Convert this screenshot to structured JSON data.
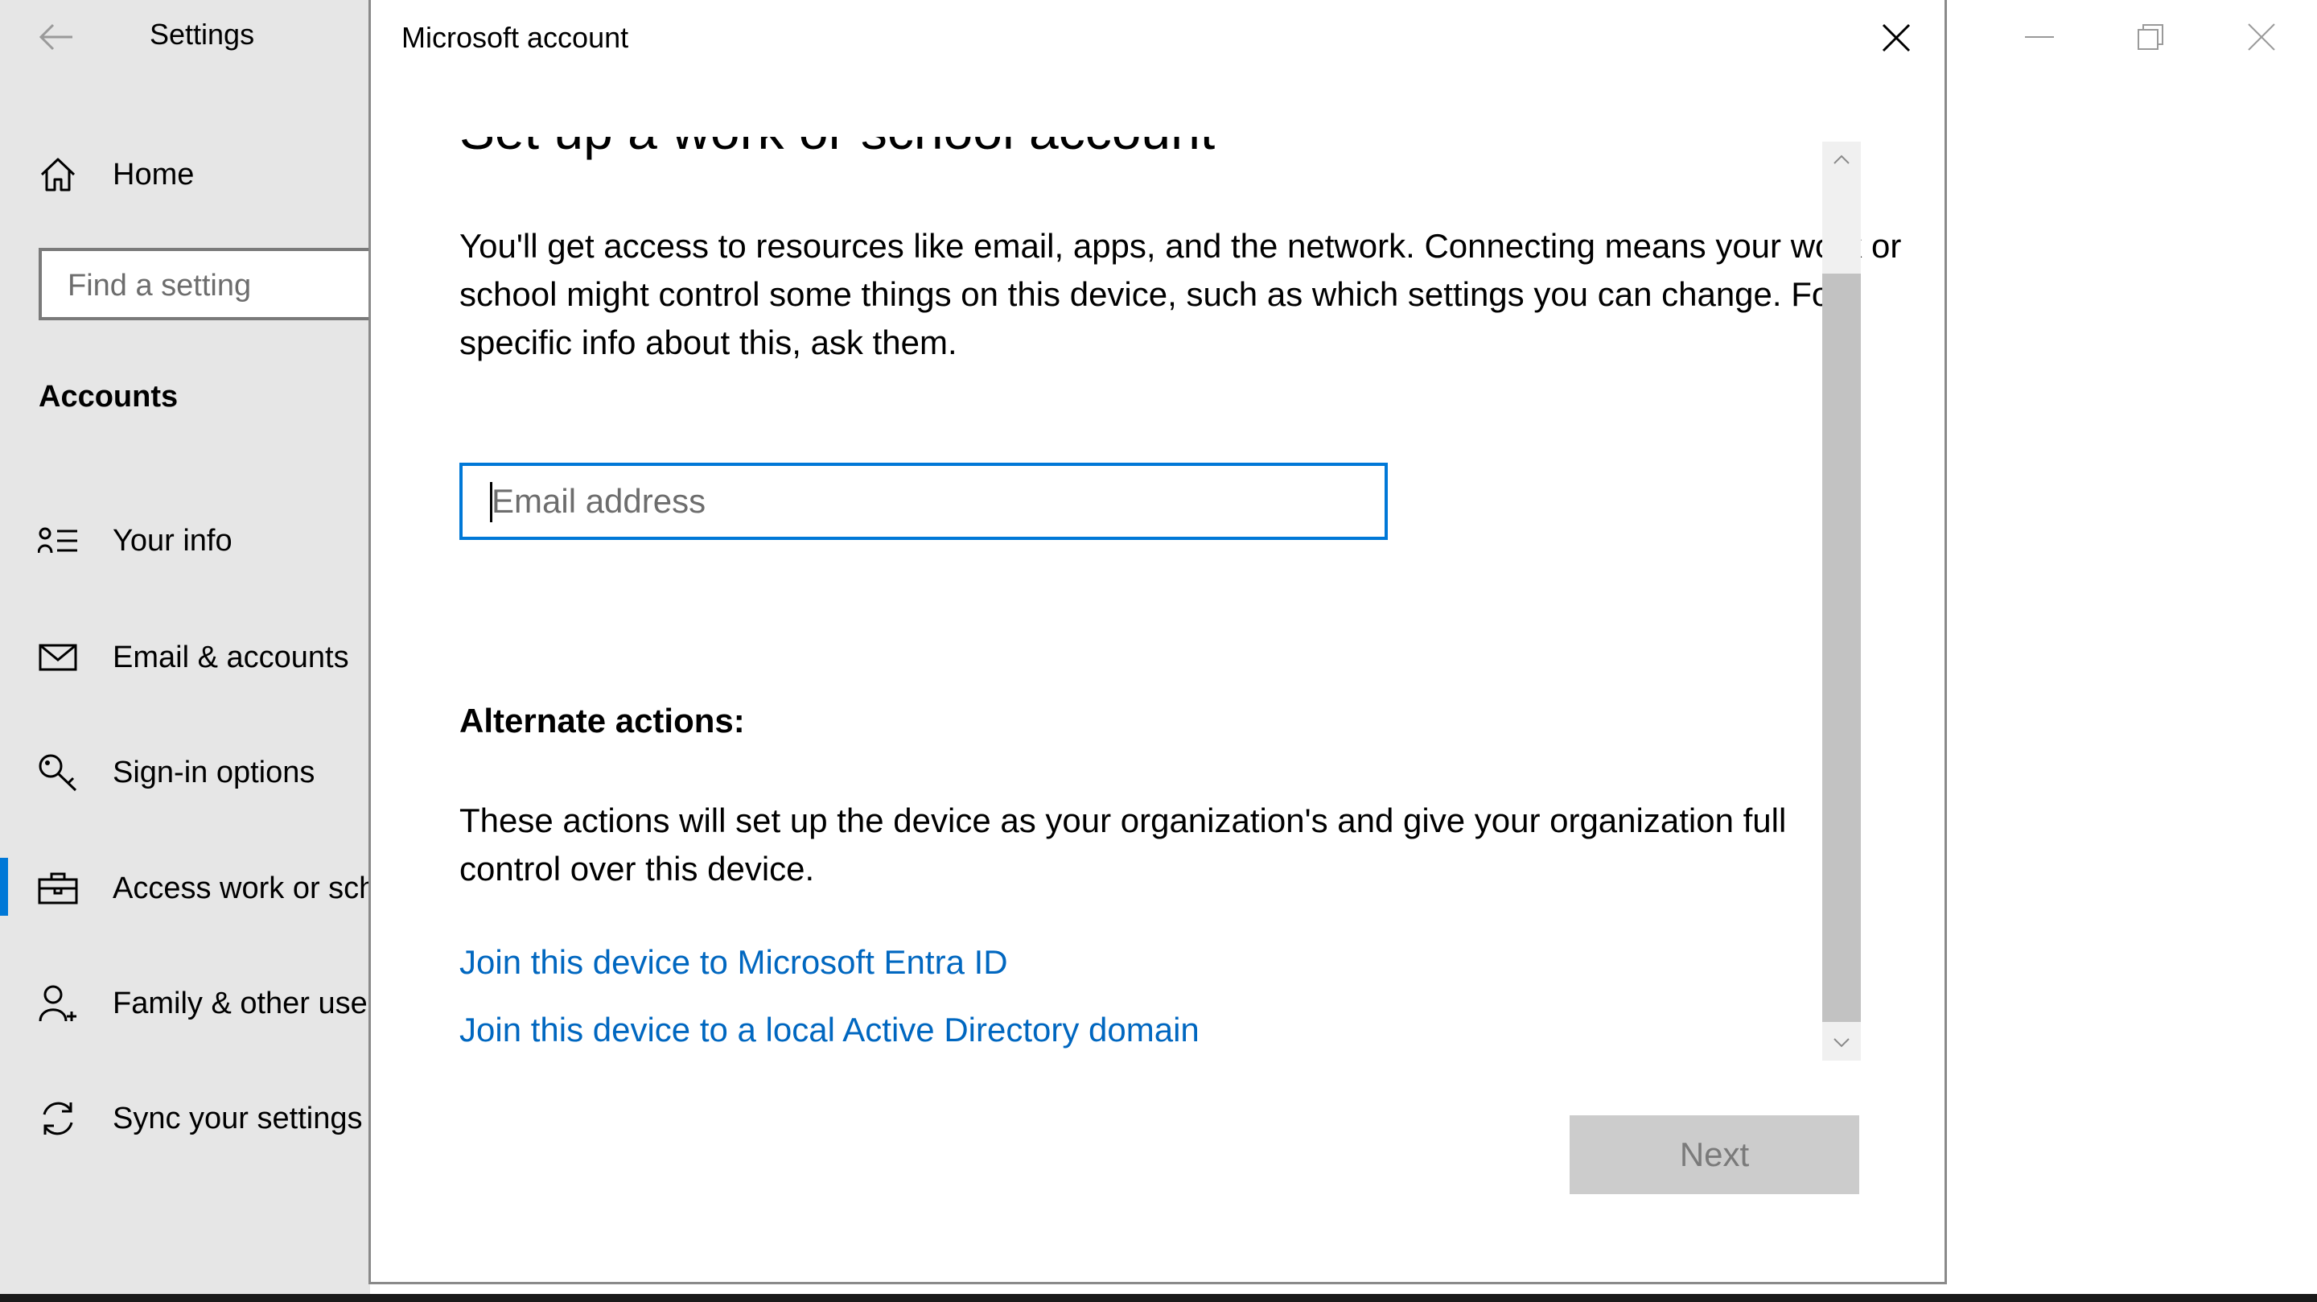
{
  "settings": {
    "app_title": "Settings",
    "back_icon": "arrow-left-icon",
    "home_label": "Home",
    "search_placeholder": "Find a setting",
    "section_heading": "Accounts",
    "accent_color": "#0078d7",
    "nav_items": [
      {
        "label": "Your info",
        "icon": "person-list-icon"
      },
      {
        "label": "Email & accounts",
        "icon": "envelope-icon"
      },
      {
        "label": "Sign-in options",
        "icon": "key-icon"
      },
      {
        "label": "Access work or school",
        "icon": "briefcase-icon",
        "selected": true
      },
      {
        "label": "Family & other users",
        "icon": "person-add-icon"
      },
      {
        "label": "Sync your settings",
        "icon": "sync-icon"
      }
    ]
  },
  "window_controls": [
    "minimize-icon",
    "restore-icon",
    "close-icon"
  ],
  "dialog": {
    "title": "Microsoft account",
    "heading": "Set up a work or school account",
    "description": "You'll get access to resources like email, apps, and the network. Connecting means your work or school might control some things on this device, such as which settings you can change. For specific info about this, ask them.",
    "email_placeholder": "Email address",
    "email_value": "",
    "alternate_heading": "Alternate actions:",
    "alternate_description": "These actions will set up the device as your organization's and give your organization full control over this device.",
    "links": [
      "Join this device to Microsoft Entra ID",
      "Join this device to a local Active Directory domain"
    ],
    "next_label": "Next",
    "link_color": "#0067c0"
  }
}
